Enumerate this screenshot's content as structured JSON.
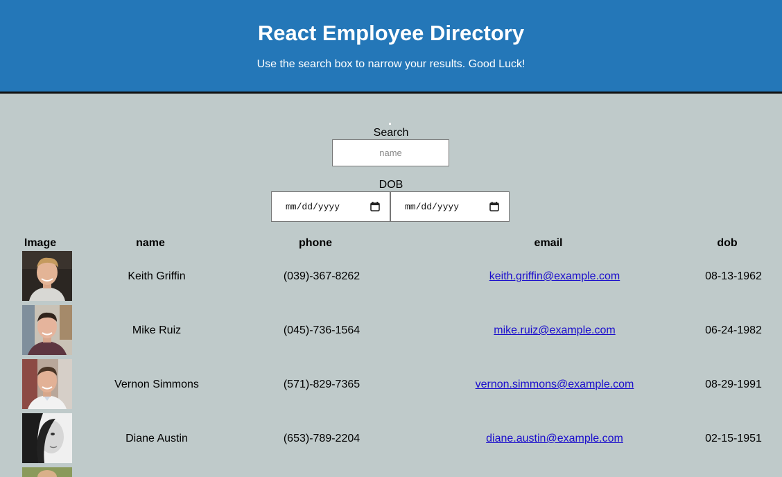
{
  "header": {
    "title": "React Employee Directory",
    "subtitle": "Use the search box to narrow your results. Good Luck!",
    "bg_color": "#2477b8"
  },
  "search": {
    "label": "Search",
    "placeholder": "name"
  },
  "dob": {
    "label": "DOB",
    "from_placeholder": "mm/dd/yyyy",
    "to_placeholder": "mm/dd/yyyy"
  },
  "table": {
    "headers": [
      "Image",
      "name",
      "phone",
      "email",
      "dob"
    ],
    "rows": [
      {
        "name": "Keith Griffin",
        "phone": "(039)-367-8262",
        "email": "keith.griffin@example.com",
        "dob": "08-13-1962"
      },
      {
        "name": "Mike Ruiz",
        "phone": "(045)-736-1564",
        "email": "mike.ruiz@example.com",
        "dob": "06-24-1982"
      },
      {
        "name": "Vernon Simmons",
        "phone": "(571)-829-7365",
        "email": "vernon.simmons@example.com",
        "dob": "08-29-1991"
      },
      {
        "name": "Diane Austin",
        "phone": "(653)-789-2204",
        "email": "diane.austin@example.com",
        "dob": "02-15-1951"
      }
    ]
  },
  "colors": {
    "page_bg": "#bfcaca",
    "link": "#1a0dcc"
  }
}
